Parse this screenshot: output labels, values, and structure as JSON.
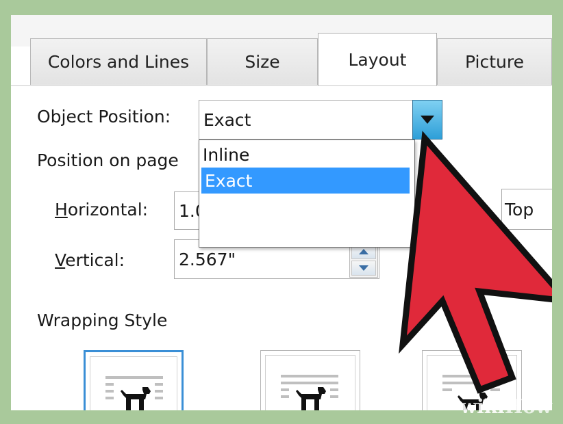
{
  "tabs": [
    {
      "label": "Colors and Lines",
      "active": false
    },
    {
      "label": "Size",
      "active": false
    },
    {
      "label": "Layout",
      "active": true
    },
    {
      "label": "Picture",
      "active": false
    }
  ],
  "object_position": {
    "label": "Object Position:",
    "value": "Exact",
    "options": [
      "Inline",
      "Exact"
    ],
    "selected_option": "Exact"
  },
  "position_on_page": {
    "label": "Position on page",
    "horizontal": {
      "label_first": "H",
      "label_rest": "orizontal:",
      "value": "1.0",
      "relative_to": "Top"
    },
    "vertical": {
      "label_first": "V",
      "label_rest": "ertical:",
      "value": "2.567\""
    }
  },
  "wrapping_style": {
    "label": "Wrapping Style"
  },
  "watermark": {
    "wiki": "wiki",
    "how": "How"
  },
  "colors": {
    "background_frame": "#a9c99b",
    "selection_blue": "#3399ff",
    "cursor_red": "#e0293a",
    "dropdown_button": "#2e9fd8"
  },
  "icons": [
    "chevron-down-icon",
    "spin-up-icon",
    "spin-down-icon",
    "dog-icon",
    "arrow-cursor-icon"
  ]
}
